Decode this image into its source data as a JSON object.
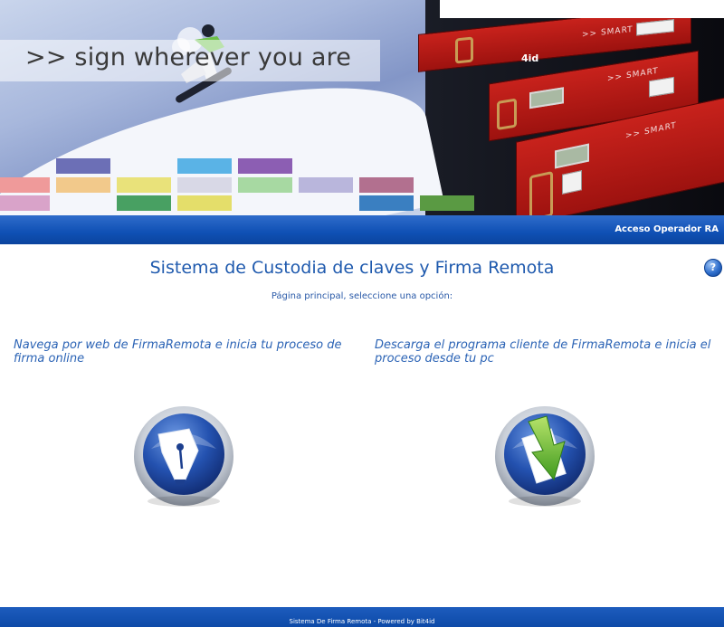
{
  "banner": {
    "slogan": ">> sign wherever you are",
    "server_label": ">> SMART",
    "brand_badge": "4id"
  },
  "top_bar": {
    "operator_link": "Acceso Operador RA"
  },
  "main": {
    "title": "Sistema de Custodia de claves y Firma Remota",
    "subtitle": "Página principal, seleccione una opción:",
    "help_icon_glyph": "?",
    "options": [
      {
        "description": "Navega por web de FirmaRemota e inicia tu proceso de firma online",
        "icon": "fountain-pen-icon"
      },
      {
        "description": "Descarga el programa cliente de FirmaRemota e inicia el proceso desde tu pc",
        "icon": "download-arrow-icon"
      }
    ]
  },
  "footer": {
    "text": "Sistema De Firma Remota - Powered by Bit4id"
  },
  "colors": {
    "primary_blue": "#0f50b4",
    "title_blue": "#1f5aae",
    "server_red": "#c8221c"
  }
}
